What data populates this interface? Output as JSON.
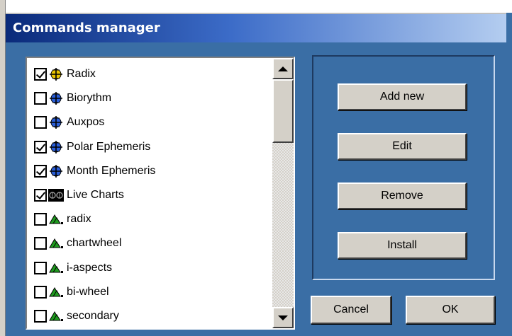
{
  "window": {
    "title": "Commands manager"
  },
  "list": {
    "items": [
      {
        "label": "Radix",
        "checked": true,
        "icon": "radix-crosshair-icon"
      },
      {
        "label": "Biorythm",
        "checked": false,
        "icon": "biorythm-crosshair-icon"
      },
      {
        "label": "Auxpos",
        "checked": false,
        "icon": "auxpos-crosshair-icon"
      },
      {
        "label": "Polar Ephemeris",
        "checked": true,
        "icon": "polar-ephemeris-crosshair-icon"
      },
      {
        "label": "Month Ephemeris",
        "checked": true,
        "icon": "month-ephemeris-crosshair-icon"
      },
      {
        "label": "Live Charts",
        "checked": true,
        "icon": "live-charts-icon"
      },
      {
        "label": "radix",
        "checked": false,
        "icon": "green-triangle-icon"
      },
      {
        "label": "chartwheel",
        "checked": false,
        "icon": "green-triangle-icon"
      },
      {
        "label": "i-aspects",
        "checked": false,
        "icon": "green-triangle-icon"
      },
      {
        "label": "bi-wheel",
        "checked": false,
        "icon": "green-triangle-icon"
      },
      {
        "label": "secondary",
        "checked": false,
        "icon": "green-triangle-icon"
      }
    ]
  },
  "buttons": {
    "add_new": "Add new",
    "edit": "Edit",
    "remove": "Remove",
    "install": "Install",
    "cancel": "Cancel",
    "ok": "OK"
  },
  "colors": {
    "dialog_bg": "#3a6ea5",
    "title_bar_start": "#0a2a7a",
    "title_bar_end": "#b4cdf0",
    "button_face": "#d4d0c8",
    "crosshair_yellow": "#e8c400",
    "crosshair_blue": "#2a5ed8",
    "triangle_green": "#1e9a1e"
  }
}
